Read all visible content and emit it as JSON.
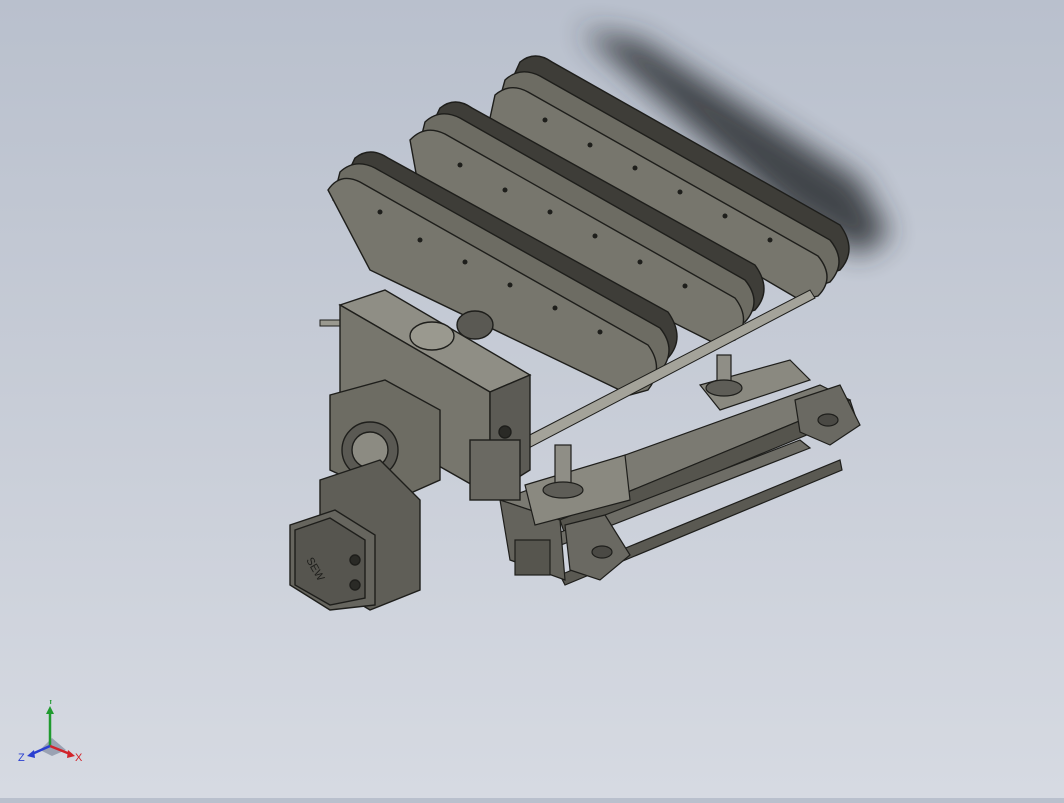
{
  "viewport": {
    "model_label": "SEW",
    "colors": {
      "background_top": "#b9c0cd",
      "background_bottom": "#d6dae2",
      "model_face": "#6d6c63",
      "model_dark": "#3a3a35",
      "edge": "#1e1e1b",
      "shadow": "#2b2e33"
    }
  },
  "triad": {
    "x_label": "X",
    "y_label": "Y",
    "z_label": "Z",
    "colors": {
      "x": "#d2232a",
      "y": "#1f9a2e",
      "z": "#2a3fd0"
    }
  }
}
